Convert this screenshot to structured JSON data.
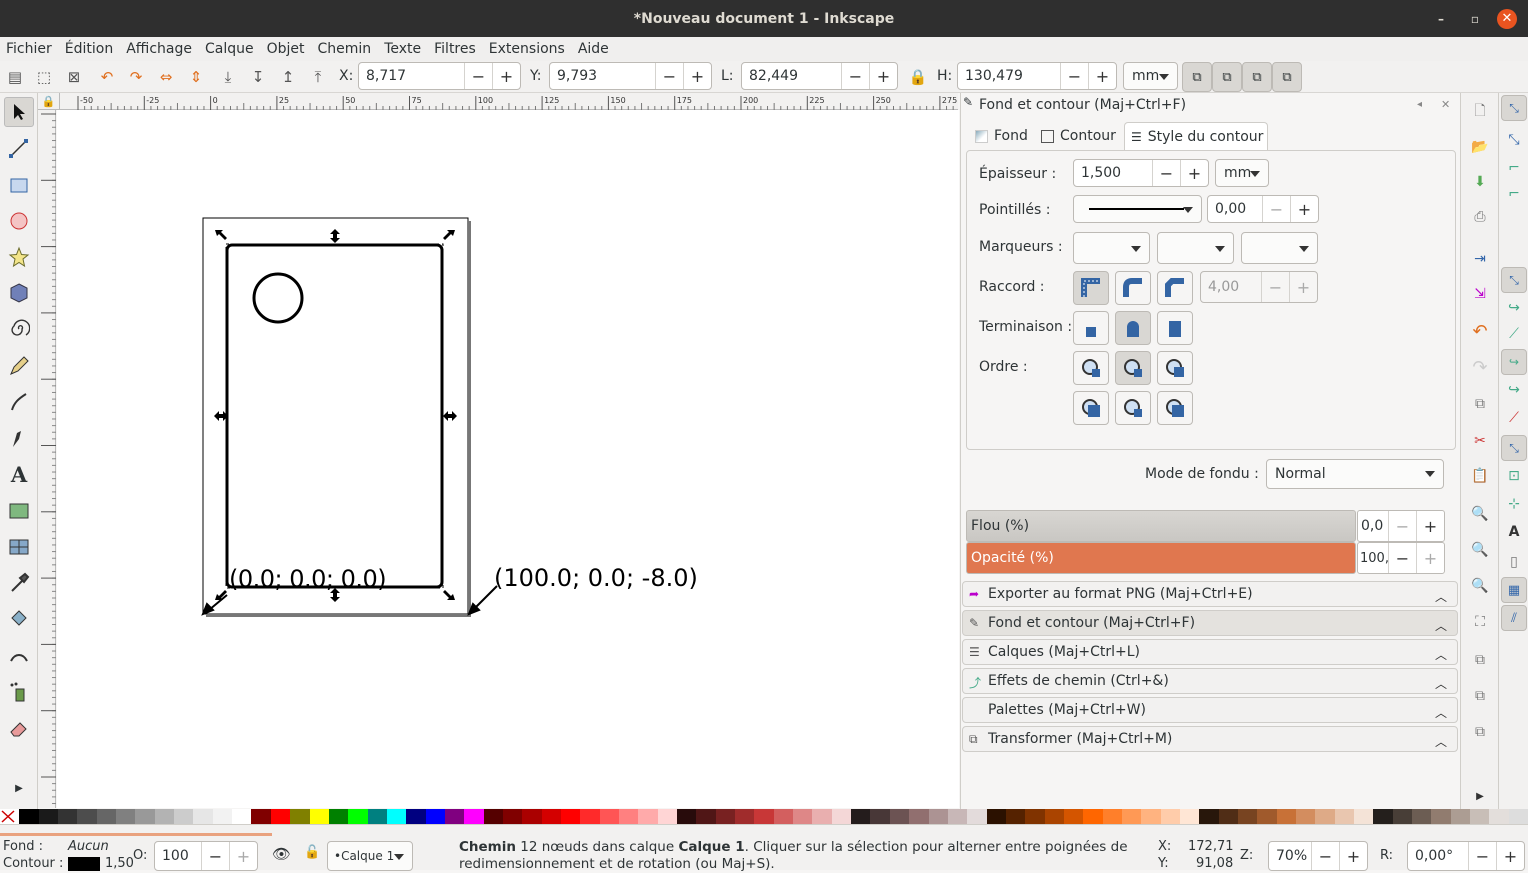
{
  "window": {
    "title": "*Nouveau document 1 - Inkscape",
    "minimize": "–",
    "maximize": "▫",
    "close": "✕"
  },
  "menu": [
    "Fichier",
    "Édition",
    "Affichage",
    "Calque",
    "Objet",
    "Chemin",
    "Texte",
    "Filtres",
    "Extensions",
    "Aide"
  ],
  "toolbar": {
    "x_label": "X:",
    "x_value": "8,717",
    "y_label": "Y:",
    "y_value": "9,793",
    "w_label": "L:",
    "w_value": "82,449",
    "h_label": "H:",
    "h_value": "130,479",
    "unit": "mm",
    "minus": "−",
    "plus": "+"
  },
  "ruler": {
    "top_ticks": [
      "-50",
      "-25",
      "0",
      "25",
      "50",
      "75",
      "100",
      "125",
      "150",
      "175",
      "200",
      "225",
      "250",
      "275"
    ]
  },
  "canvas": {
    "label_left": "(0.0; 0.0; 0.0)",
    "label_right": "(100.0; 0.0; -8.0)"
  },
  "fill_stroke": {
    "title": "Fond et contour (Maj+Ctrl+F)",
    "tabs": [
      "Fond",
      "Contour",
      "Style du contour"
    ],
    "active_tab": "Style du contour",
    "width_label": "Épaisseur :",
    "width_value": "1,500",
    "width_unit": "mm",
    "dash_label": "Pointillés :",
    "dash_offset": "0,00",
    "markers_label": "Marqueurs :",
    "join_label": "Raccord :",
    "miter_value": "4,00",
    "cap_label": "Terminaison :",
    "order_label": "Ordre :",
    "blend_label": "Mode de fondu :",
    "blend_value": "Normal",
    "blur_label": "Flou (%)",
    "blur_value": "0,0",
    "opacity_label": "Opacité (%)",
    "opacity_value": "100,0",
    "opacity_color": "#e0774f"
  },
  "docks": [
    {
      "label": "Exporter au format PNG (Maj+Ctrl+E)",
      "icon": "export-icon"
    },
    {
      "label": "Fond et contour (Maj+Ctrl+F)",
      "icon": "fill-stroke-icon"
    },
    {
      "label": "Calques (Maj+Ctrl+L)",
      "icon": "layers-icon"
    },
    {
      "label": "Effets de chemin (Ctrl+&)",
      "icon": "path-effects-icon"
    },
    {
      "label": "Palettes (Maj+Ctrl+W)",
      "icon": ""
    },
    {
      "label": "Transformer (Maj+Ctrl+M)",
      "icon": "transform-icon"
    }
  ],
  "status": {
    "fill_label": "Fond :",
    "fill_value": "Aucun",
    "stroke_label": "Contour :",
    "stroke_width": "1,50",
    "opacity_label": "O:",
    "opacity_value": "100",
    "layer": "•Calque 1",
    "message_bold1": "Chemin",
    "message_part1": " 12 nœuds dans calque ",
    "message_bold2": "Calque 1",
    "message_part2": ". Cliquer sur la sélection pour alterner entre poignées de redimensionnement et de rotation (ou Maj+S).",
    "x_label": "X:",
    "x_value": "172,71",
    "y_label": "Y:",
    "y_value": "91,08",
    "zoom_label": "Z:",
    "zoom_value": "70%",
    "rotate_label": "R:",
    "rotate_value": "0,00°"
  },
  "colors": {
    "accent": "#e95420",
    "selection": "#000000"
  }
}
